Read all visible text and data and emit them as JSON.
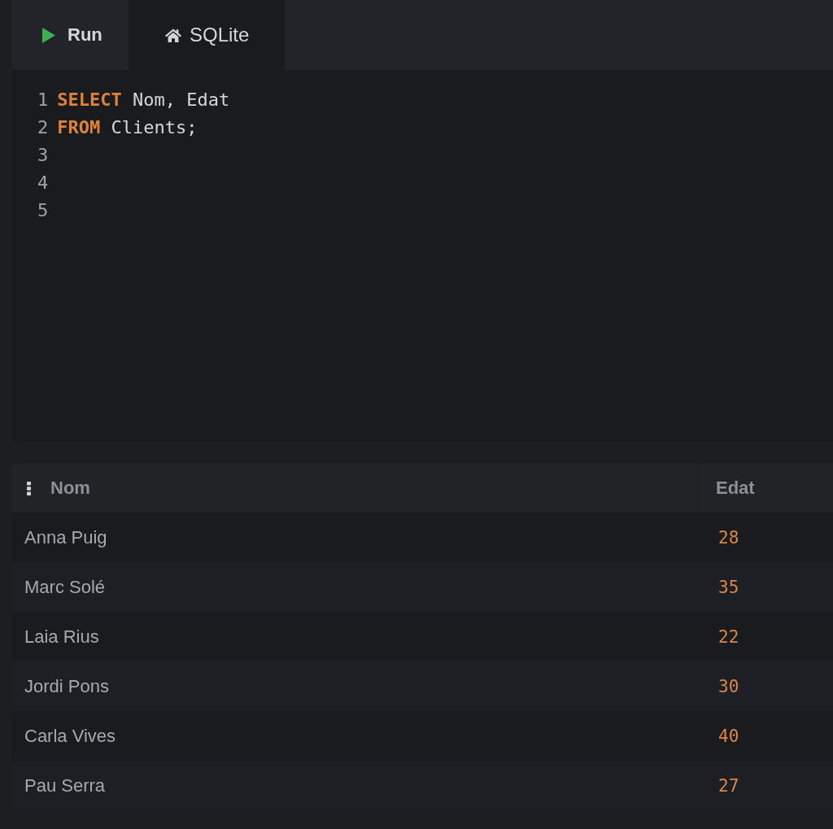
{
  "run_button": {
    "label": "Run"
  },
  "tabs": [
    {
      "label": "SQLite",
      "selected": true
    }
  ],
  "editor": {
    "lines": [
      {
        "number": "1",
        "tokens": [
          {
            "kind": "keyword",
            "text": "SELECT"
          },
          {
            "kind": "plain",
            "text": " Nom, Edat"
          }
        ]
      },
      {
        "number": "2",
        "tokens": [
          {
            "kind": "keyword",
            "text": "FROM"
          },
          {
            "kind": "plain",
            "text": " Clients;"
          }
        ]
      },
      {
        "number": "3"
      },
      {
        "number": "4"
      },
      {
        "number": "5"
      }
    ]
  },
  "table": {
    "columns": [
      {
        "label": "Nom",
        "kind": "text"
      },
      {
        "label": "Edat",
        "kind": "number"
      }
    ],
    "rows": [
      [
        "Anna Puig",
        "28"
      ],
      [
        "Marc Solé",
        "35"
      ],
      [
        "Laia Rius",
        "22"
      ],
      [
        "Jordi Pons",
        "30"
      ],
      [
        "Carla Vives",
        "40"
      ],
      [
        "Pau Serra",
        "27"
      ]
    ]
  }
}
